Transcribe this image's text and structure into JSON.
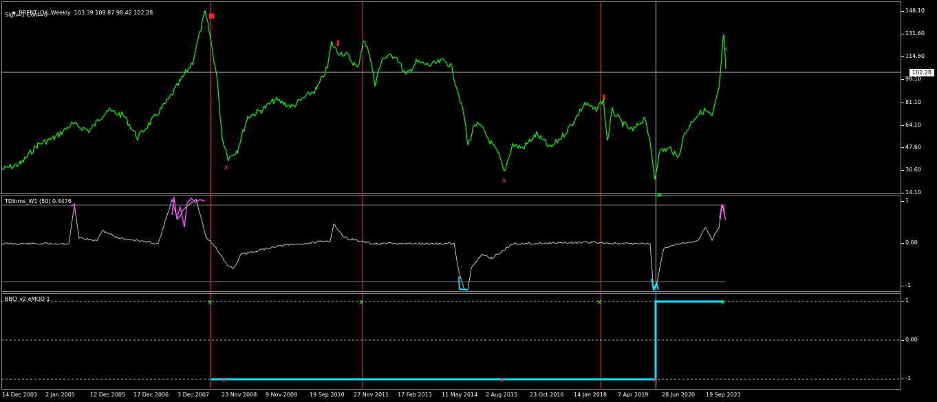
{
  "main": {
    "symbol_line": "BRENT_OIL,Weekly  103.39 109.87 98.42 102.28",
    "sign_line": "Sign=1 Conf=0",
    "current_price": "102.28",
    "scale": [
      "148.10",
      "131.60",
      "114.60",
      "98.10",
      "81.10",
      "64.10",
      "47.60",
      "30.60",
      "14.10"
    ],
    "colors": {
      "price_line": "#00ff00",
      "signal_marker": "#ff2020",
      "bid_line": "#c0c0c0"
    }
  },
  "indicator1": {
    "label": "TDInms_W1 (50) 0.4476",
    "scale": [
      "1",
      "0.00",
      "-1"
    ],
    "colors": {
      "line": "#c0c0c0",
      "high": "#ff40ff",
      "low": "#00e5ff"
    }
  },
  "indicator2": {
    "label": "BBCI v2 eMOD 1",
    "scale": [
      "1",
      "0.00",
      "-1"
    ],
    "colors": {
      "line": "#00e5ff",
      "marker_up": "#20ff20",
      "marker_down": "#ff3030"
    }
  },
  "time_axis": [
    "14 Dec 2003",
    "2 Jan 2005",
    "12 Dec 2005",
    "17 Dec 2006",
    "3 Dec 2007",
    "23 Nov 2008",
    "9 Nov 2009",
    "19 Sep 2010",
    "27 Nov 2011",
    "17 Feb 2013",
    "11 May 2014",
    "2 Aug 2015",
    "23 Oct 2016",
    "14 Jan 2018",
    "7 Apr 2019",
    "28 Jun 2020",
    "19 Sep 2021"
  ]
}
